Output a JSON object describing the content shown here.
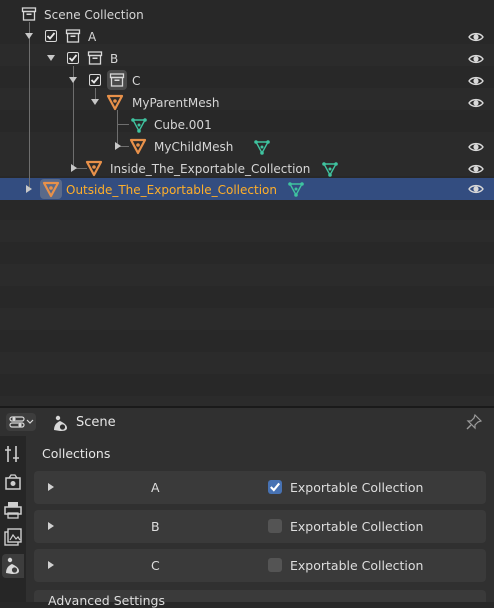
{
  "outliner": {
    "scene_collection": "Scene Collection",
    "items": [
      {
        "label": "A"
      },
      {
        "label": "B"
      },
      {
        "label": "C"
      },
      {
        "label": "MyParentMesh"
      },
      {
        "label": "Cube.001"
      },
      {
        "label": "MyChildMesh"
      },
      {
        "label": "Inside_The_Exportable_Collection"
      },
      {
        "label": "Outside_The_Exportable_Collection"
      }
    ]
  },
  "properties": {
    "context": "Scene",
    "section_title": "Collections",
    "panels": [
      {
        "name": "A",
        "checkbox_label": "Exportable Collection",
        "checked": true
      },
      {
        "name": "B",
        "checkbox_label": "Exportable Collection",
        "checked": false
      },
      {
        "name": "C",
        "checkbox_label": "Exportable Collection",
        "checked": false
      }
    ],
    "next_panel": "Advanced Settings"
  },
  "colors": {
    "selection_row": "#334d80",
    "selected_text": "#ffaf29",
    "checkbox_on": "#4772b3",
    "object_orange": "#e8914a",
    "mesh_green": "#3fc4a0"
  },
  "icons": {
    "collection": "collection-icon",
    "object": "object-icon",
    "mesh": "mesh-data-icon",
    "visibility": "eye-icon",
    "pin": "pin-icon"
  }
}
